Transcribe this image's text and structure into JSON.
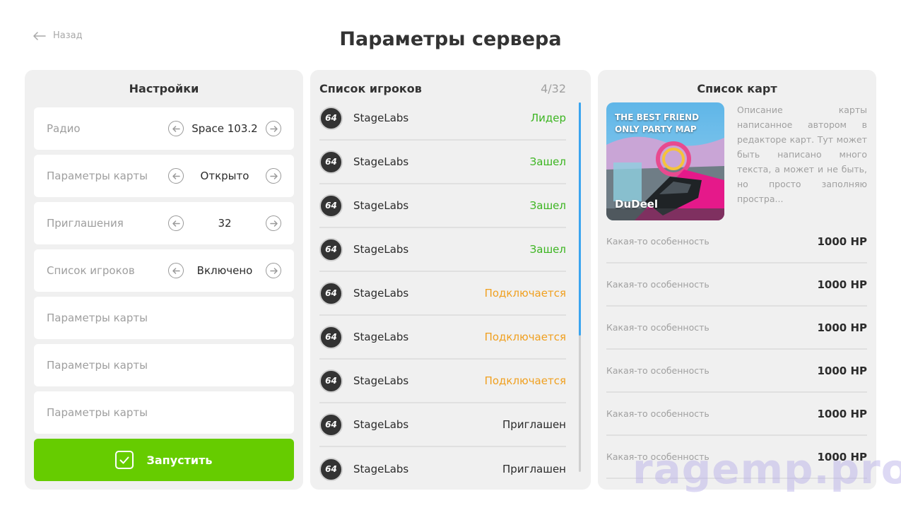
{
  "nav": {
    "back_label": "Назад"
  },
  "page": {
    "title": "Параметры сервера"
  },
  "settings": {
    "title": "Настройки",
    "steppers": [
      {
        "label": "Радио",
        "value": "Space 103.2"
      },
      {
        "label": "Параметры карты",
        "value": "Открыто"
      },
      {
        "label": "Приглашения",
        "value": "32"
      },
      {
        "label": "Список игроков",
        "value": "Включено"
      }
    ],
    "fields": [
      {
        "label": "Параметры карты"
      },
      {
        "label": "Параметры карты"
      },
      {
        "label": "Параметры карты"
      }
    ],
    "start_label": "Запустить"
  },
  "players": {
    "title": "Список игроков",
    "count": "4/32",
    "items": [
      {
        "avatar": "64",
        "name": "StageLabs",
        "status": "Лидер",
        "status_color": "#3cb521"
      },
      {
        "avatar": "64",
        "name": "StageLabs",
        "status": "Зашел",
        "status_color": "#3cb521"
      },
      {
        "avatar": "64",
        "name": "StageLabs",
        "status": "Зашел",
        "status_color": "#3cb521"
      },
      {
        "avatar": "64",
        "name": "StageLabs",
        "status": "Зашел",
        "status_color": "#3cb521"
      },
      {
        "avatar": "64",
        "name": "StageLabs",
        "status": "Подключается",
        "status_color": "#f0a020"
      },
      {
        "avatar": "64",
        "name": "StageLabs",
        "status": "Подключается",
        "status_color": "#f0a020"
      },
      {
        "avatar": "64",
        "name": "StageLabs",
        "status": "Подключается",
        "status_color": "#f0a020"
      },
      {
        "avatar": "64",
        "name": "StageLabs",
        "status": "Приглашен",
        "status_color": "#2b2b2b"
      },
      {
        "avatar": "64",
        "name": "StageLabs",
        "status": "Приглашен",
        "status_color": "#2b2b2b"
      }
    ]
  },
  "maps": {
    "title": "Список карт",
    "thumb_title": "THE BEST FRIEND ONLY PARTY MAP",
    "author": "DuDeel",
    "description": "Описание карты написанное автором в редакторе карт. Тут может быть написано много текста, а может и не быть, но просто заполняю простра...",
    "features": [
      {
        "label": "Какая-то особенность",
        "value": "1000 HP"
      },
      {
        "label": "Какая-то особенность",
        "value": "1000 HP"
      },
      {
        "label": "Какая-то особенность",
        "value": "1000 HP"
      },
      {
        "label": "Какая-то особенность",
        "value": "1000 HP"
      },
      {
        "label": "Какая-то особенность",
        "value": "1000 HP"
      },
      {
        "label": "Какая-то особенность",
        "value": "1000 HP"
      }
    ]
  },
  "watermark": "ragemp.pro",
  "colors": {
    "accent_green": "#66cc00",
    "scroll_blue": "#3aa4ef",
    "panel_bg": "#f0f0f0"
  }
}
